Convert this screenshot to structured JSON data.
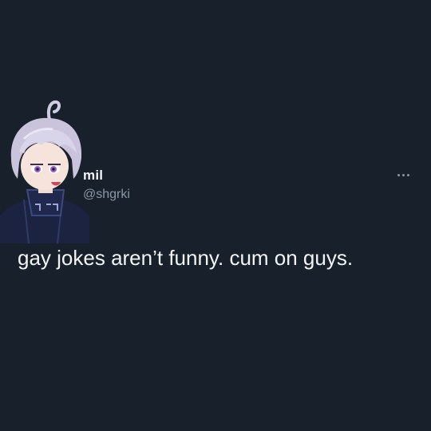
{
  "tweet": {
    "author": {
      "display_name": "mil",
      "handle": "@shgrki",
      "avatar_icon": "anime-character-avatar"
    },
    "more_icon": "more-horizontal-icon",
    "text": "gay jokes aren’t funny. cum on guys."
  },
  "colors": {
    "background": "#18202b",
    "primary_text": "#f3f4f5",
    "secondary_text": "#8b98a5"
  }
}
